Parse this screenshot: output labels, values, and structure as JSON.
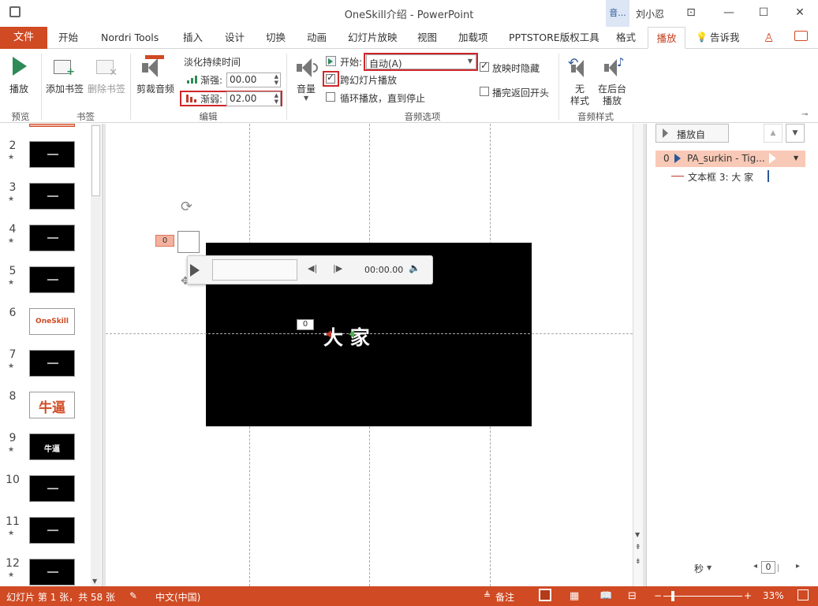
{
  "window": {
    "title": "OneSkill介绍  -  PowerPoint",
    "tool_tab": "音...",
    "user": "刘小忍"
  },
  "tabs": {
    "file": "文件",
    "items": [
      "开始",
      "Nordri Tools",
      "插入",
      "设计",
      "切换",
      "动画",
      "幻灯片放映",
      "视图",
      "加载项",
      "PPTSTORE版权工具",
      "格式",
      "播放"
    ],
    "active": "播放",
    "tell_me": "告诉我"
  },
  "ribbon": {
    "preview": {
      "play": "播放",
      "label": "预览"
    },
    "bookmarks": {
      "add": "添加书签",
      "remove": "删除书签",
      "label": "书签"
    },
    "edit": {
      "trim": "剪裁音频",
      "fade_title": "淡化持续时间",
      "fade_in_label": "渐强:",
      "fade_in_value": "00.00",
      "fade_out_label": "渐弱:",
      "fade_out_value": "02.00",
      "label": "编辑"
    },
    "audio_options": {
      "volume": "音量",
      "start_label": "开始:",
      "start_value": "自动(A)",
      "hide_label": "放映时隐藏",
      "hide_checked": true,
      "cross_slides_label": "跨幻灯片播放",
      "cross_slides_checked": true,
      "loop_label": "循环播放，直到停止",
      "loop_checked": false,
      "rewind_label": "播完返回开头",
      "rewind_checked": false,
      "label": "音频选项"
    },
    "audio_styles": {
      "none_line1": "无",
      "none_line2": "样式",
      "bg_line1": "在后台",
      "bg_line2": "播放",
      "label": "音频样式"
    }
  },
  "thumbnails": {
    "slides": [
      {
        "num": "2",
        "star": true,
        "text": "",
        "white": false
      },
      {
        "num": "3",
        "star": true,
        "text": "",
        "white": false
      },
      {
        "num": "4",
        "star": true,
        "text": "",
        "white": false
      },
      {
        "num": "5",
        "star": true,
        "text": "",
        "white": false
      },
      {
        "num": "6",
        "star": false,
        "text": "OneSkill",
        "white": true
      },
      {
        "num": "7",
        "star": true,
        "text": "",
        "white": false
      },
      {
        "num": "8",
        "star": false,
        "text": "牛逼",
        "white": true
      },
      {
        "num": "9",
        "star": true,
        "text": "牛逼",
        "white": false
      },
      {
        "num": "10",
        "star": false,
        "text": "",
        "white": false
      },
      {
        "num": "11",
        "star": true,
        "text": "",
        "white": false
      },
      {
        "num": "12",
        "star": true,
        "text": "",
        "white": false
      }
    ]
  },
  "slide": {
    "text": "大 家",
    "audio_tag": "0",
    "text_tag": "0",
    "player_time": "00:00.00"
  },
  "animation_pane": {
    "play_from": "播放自",
    "item_index": "0",
    "item_name": "PA_surkin - Tig...",
    "sub_item": "文本框 3: 大 家",
    "time_unit": "秒",
    "page": "0"
  },
  "status": {
    "slide_info": "幻灯片 第 1 张，共 58 张",
    "language": "中文(中国)",
    "notes": "备注",
    "zoom": "33%"
  },
  "colors": {
    "accent": "#d04a23",
    "highlight": "#d0272b"
  }
}
